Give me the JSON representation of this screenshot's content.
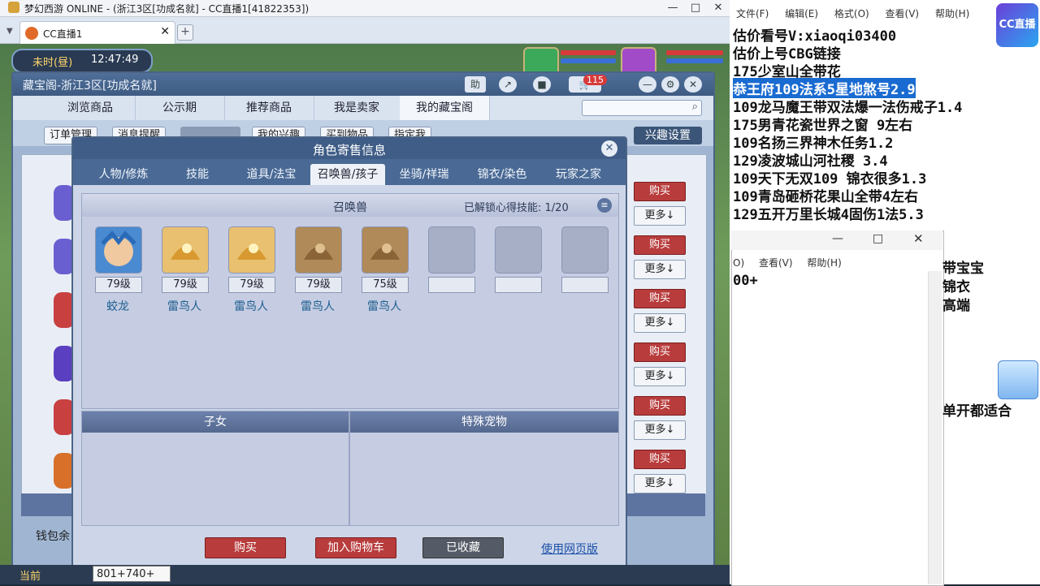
{
  "game_window": {
    "title": "梦幻西游 ONLINE - (浙江3区[功成名就] - CC直播1[41822353])",
    "tab_label": "CC直播1",
    "time_badge_period": "未时(昼)",
    "time_badge_clock": "12:47:49"
  },
  "cbg": {
    "title": "藏宝阁-浙江3区[功成名就]",
    "help_label": "助",
    "cart_count": "115",
    "nav_tabs": [
      "浏览商品",
      "公示期",
      "推荐商品",
      "我是卖家",
      "我的藏宝阁"
    ],
    "sub_buttons": [
      "订单管理",
      "消息提醒",
      "",
      "我的兴趣",
      "买到物品",
      "指定我"
    ],
    "interest_btn": "兴趣设置",
    "wallet_label": "钱包余",
    "buy_label": "购买",
    "more_label": "更多↓"
  },
  "modal": {
    "title": "角色寄售信息",
    "close_label": "✕",
    "tabs": [
      "人物/修炼",
      "技能",
      "道具/法宝",
      "召唤兽/孩子",
      "坐骑/祥瑞",
      "锦衣/染色",
      "玩家之家"
    ],
    "active_tab": "召唤兽/孩子",
    "pets_title": "召唤兽",
    "skill_unlock_label": "已解锁心得技能:",
    "skill_unlock_value": "1/20",
    "pets": [
      {
        "level": "79级",
        "name": "蛟龙"
      },
      {
        "level": "79级",
        "name": "雷鸟人"
      },
      {
        "level": "79级",
        "name": "雷鸟人"
      },
      {
        "level": "79级",
        "name": "雷鸟人"
      },
      {
        "level": "75级",
        "name": "雷鸟人"
      },
      {
        "level": "",
        "name": ""
      },
      {
        "level": "",
        "name": ""
      },
      {
        "level": "",
        "name": ""
      }
    ],
    "children_title": "子女",
    "special_pets_title": "特殊宠物",
    "footer": {
      "buy": "购买",
      "add_cart": "加入购物车",
      "favorited": "已收藏",
      "web_version": "使用网页版"
    }
  },
  "bottom_bar": {
    "channel": "当前",
    "chat_value": "801+740+"
  },
  "notepad": {
    "menu": [
      "文件(F)",
      "编辑(E)",
      "格式(O)",
      "查看(V)",
      "帮助(H)"
    ],
    "lines": [
      "估价看号V:xiaoqi03400",
      "估价上号CBG链接",
      "175少室山全带花",
      "恭王府109法系5星地煞号2.9",
      "109龙马魔王带双法爆一法伤戒子1.4",
      "175男青花瓷世界之窗  9左右",
      "109名扬三界神木任务1.2",
      "129凌波城山河社稷  3.4",
      "109天下无双109  锦衣很多1.3",
      "109青岛砸桥花果山全带4左右",
      "129五开万里长城4固伤1法5.3"
    ],
    "selected_line_index": 3,
    "second_menu": [
      "O)",
      "查看(V)",
      "帮助(H)"
    ],
    "second_text": "00+",
    "behind_lines": [
      "带宝宝",
      "锦衣",
      "高端",
      "单开都适合"
    ]
  },
  "overlay": {
    "cc_logo": "CC直播"
  },
  "colors": {
    "accent": "#3f5d86",
    "buy_red": "#b83c3c",
    "selection": "#1a6bd1",
    "pet_name": "#1e5f8f"
  }
}
